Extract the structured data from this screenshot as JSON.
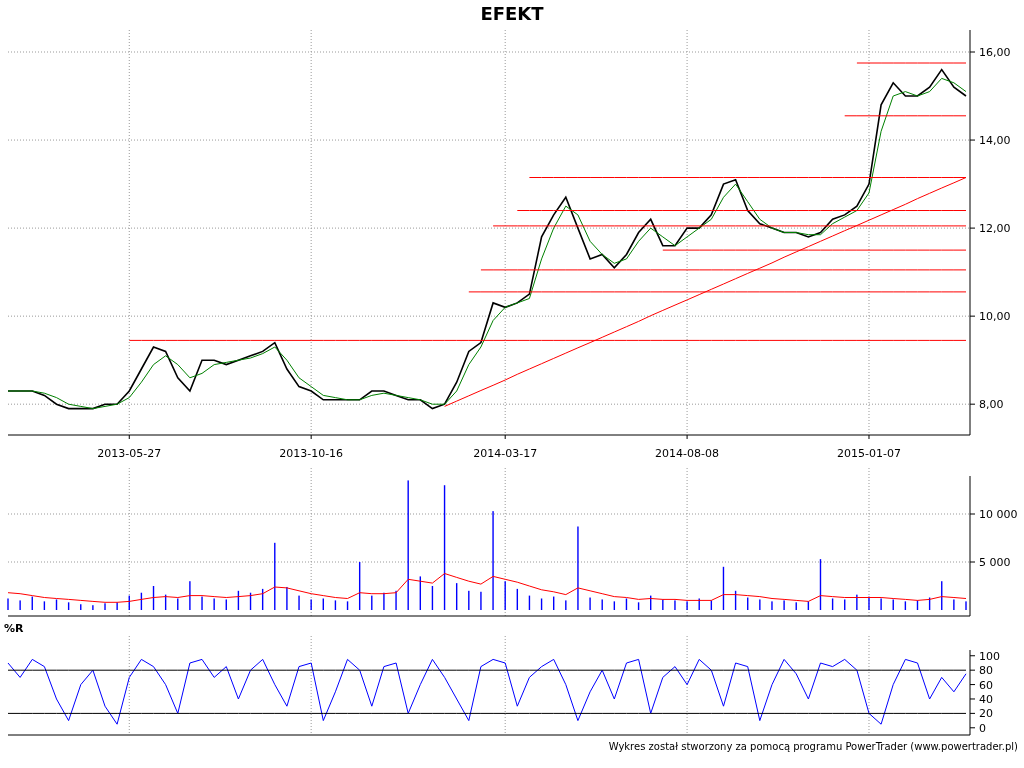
{
  "title": "EFEKT",
  "price_panel": {
    "chart_data": {
      "type": "line",
      "grid": true,
      "ylim": [
        7.3,
        16.5
      ],
      "categories": [
        null,
        null,
        null,
        null,
        null,
        null,
        null,
        null,
        null,
        null,
        "2013-05-27",
        null,
        null,
        null,
        null,
        null,
        null,
        null,
        null,
        null,
        null,
        null,
        null,
        null,
        null,
        "2013-10-16",
        null,
        null,
        null,
        null,
        null,
        null,
        null,
        null,
        null,
        null,
        null,
        null,
        null,
        null,
        null,
        "2014-03-17",
        null,
        null,
        null,
        null,
        null,
        null,
        null,
        null,
        null,
        null,
        null,
        null,
        null,
        null,
        "2014-08-08",
        null,
        null,
        null,
        null,
        null,
        null,
        null,
        null,
        null,
        null,
        null,
        null,
        null,
        null,
        "2015-01-07",
        null,
        null,
        null,
        null,
        null,
        null,
        null,
        null
      ],
      "yticks": [
        {
          "value": 8,
          "label": "8,00"
        },
        {
          "value": 10,
          "label": "10,00"
        },
        {
          "value": 12,
          "label": "12,00"
        },
        {
          "value": 14,
          "label": "14,00"
        },
        {
          "value": 16,
          "label": "16,00"
        }
      ],
      "series": [
        {
          "color": "#000000",
          "values": [
            8.3,
            8.3,
            8.3,
            8.2,
            8.0,
            7.9,
            7.9,
            7.9,
            8.0,
            8.0,
            8.3,
            8.8,
            9.3,
            9.2,
            8.6,
            8.3,
            9.0,
            9.0,
            8.9,
            9.0,
            9.1,
            9.2,
            9.4,
            8.8,
            8.4,
            8.3,
            8.1,
            8.1,
            8.1,
            8.1,
            8.3,
            8.3,
            8.2,
            8.1,
            8.1,
            7.9,
            8.0,
            8.5,
            9.2,
            9.4,
            10.3,
            10.2,
            10.3,
            10.5,
            11.8,
            12.3,
            12.7,
            12.0,
            11.3,
            11.4,
            11.1,
            11.4,
            11.9,
            12.2,
            11.6,
            11.6,
            12.0,
            12.0,
            12.3,
            13.0,
            13.1,
            12.4,
            12.1,
            12.0,
            11.9,
            11.9,
            11.8,
            11.9,
            12.2,
            12.3,
            12.5,
            13.0,
            14.8,
            15.3,
            15.0,
            15.0,
            15.2,
            15.6,
            15.2,
            15.0
          ]
        },
        {
          "color": "#008000",
          "values": [
            8.3,
            8.3,
            8.3,
            8.25,
            8.15,
            8.0,
            7.95,
            7.9,
            7.95,
            8.0,
            8.15,
            8.5,
            8.9,
            9.1,
            8.9,
            8.6,
            8.7,
            8.9,
            8.95,
            9.0,
            9.05,
            9.15,
            9.3,
            9.0,
            8.6,
            8.4,
            8.2,
            8.15,
            8.1,
            8.1,
            8.2,
            8.25,
            8.2,
            8.15,
            8.1,
            8.0,
            8.0,
            8.3,
            8.9,
            9.3,
            9.9,
            10.2,
            10.3,
            10.4,
            11.3,
            12.0,
            12.5,
            12.3,
            11.7,
            11.4,
            11.2,
            11.3,
            11.7,
            12.0,
            11.8,
            11.6,
            11.8,
            12.0,
            12.2,
            12.7,
            13.0,
            12.6,
            12.2,
            12.0,
            11.9,
            11.9,
            11.85,
            11.85,
            12.1,
            12.25,
            12.4,
            12.8,
            14.2,
            15.0,
            15.1,
            15.0,
            15.1,
            15.4,
            15.3,
            15.1
          ]
        },
        {
          "color": "#ff0000",
          "values": [
            null,
            null,
            null,
            null,
            null,
            null,
            null,
            null,
            null,
            null,
            9.45,
            9.45,
            9.45,
            9.45,
            9.45,
            9.45,
            9.45,
            9.45,
            9.45,
            9.45,
            9.45,
            9.45,
            9.45,
            9.45,
            9.45,
            9.45,
            9.45,
            9.45,
            9.45,
            9.45,
            9.45,
            9.45,
            9.45,
            9.45,
            9.45,
            9.45,
            9.45,
            9.45,
            9.45,
            9.45,
            9.45,
            9.45,
            9.45,
            9.45,
            9.45,
            9.45,
            9.45,
            9.45,
            9.45,
            9.45,
            9.45,
            9.45,
            9.45,
            9.45,
            9.45,
            9.45,
            9.45,
            9.45,
            9.45,
            9.45,
            9.45,
            9.45,
            9.45,
            9.45,
            9.45,
            9.45,
            9.45,
            9.45,
            9.45,
            9.45,
            9.45,
            9.45,
            9.45,
            9.45,
            9.45,
            9.45,
            9.45,
            9.45,
            9.45,
            9.45
          ]
        },
        {
          "color": "#ff0000",
          "values": [
            null,
            null,
            null,
            null,
            null,
            null,
            null,
            null,
            null,
            null,
            null,
            null,
            null,
            null,
            null,
            null,
            null,
            null,
            null,
            null,
            null,
            null,
            null,
            null,
            null,
            null,
            null,
            null,
            null,
            null,
            null,
            null,
            null,
            null,
            null,
            null,
            null,
            null,
            10.55,
            10.55,
            10.55,
            10.55,
            10.55,
            10.55,
            10.55,
            10.55,
            10.55,
            10.55,
            10.55,
            10.55,
            10.55,
            10.55,
            10.55,
            10.55,
            10.55,
            10.55,
            10.55,
            10.55,
            10.55,
            10.55,
            10.55,
            10.55,
            10.55,
            10.55,
            10.55,
            10.55,
            10.55,
            10.55,
            10.55,
            10.55,
            10.55,
            10.55,
            10.55,
            10.55,
            10.55,
            10.55,
            10.55,
            10.55,
            10.55,
            10.55
          ]
        },
        {
          "color": "#ff0000",
          "values": [
            null,
            null,
            null,
            null,
            null,
            null,
            null,
            null,
            null,
            null,
            null,
            null,
            null,
            null,
            null,
            null,
            null,
            null,
            null,
            null,
            null,
            null,
            null,
            null,
            null,
            null,
            null,
            null,
            null,
            null,
            null,
            null,
            null,
            null,
            null,
            null,
            null,
            null,
            null,
            11.05,
            11.05,
            11.05,
            11.05,
            11.05,
            11.05,
            11.05,
            11.05,
            11.05,
            11.05,
            11.05,
            11.05,
            11.05,
            11.05,
            11.05,
            11.05,
            11.05,
            11.05,
            11.05,
            11.05,
            11.05,
            11.05,
            11.05,
            11.05,
            11.05,
            11.05,
            11.05,
            11.05,
            11.05,
            11.05,
            11.05,
            11.05,
            11.05,
            11.05,
            11.05,
            11.05,
            11.05,
            11.05,
            11.05,
            11.05,
            11.05
          ]
        },
        {
          "color": "#ff0000",
          "values": [
            null,
            null,
            null,
            null,
            null,
            null,
            null,
            null,
            null,
            null,
            null,
            null,
            null,
            null,
            null,
            null,
            null,
            null,
            null,
            null,
            null,
            null,
            null,
            null,
            null,
            null,
            null,
            null,
            null,
            null,
            null,
            null,
            null,
            null,
            null,
            null,
            null,
            null,
            null,
            null,
            null,
            null,
            null,
            null,
            null,
            null,
            null,
            null,
            null,
            null,
            null,
            null,
            null,
            null,
            11.5,
            11.5,
            11.5,
            11.5,
            11.5,
            11.5,
            11.5,
            11.5,
            11.5,
            11.5,
            11.5,
            11.5,
            11.5,
            11.5,
            11.5,
            11.5,
            11.5,
            11.5,
            11.5,
            11.5,
            11.5,
            11.5,
            11.5,
            11.5,
            11.5,
            11.5
          ]
        },
        {
          "color": "#ff0000",
          "values": [
            null,
            null,
            null,
            null,
            null,
            null,
            null,
            null,
            null,
            null,
            null,
            null,
            null,
            null,
            null,
            null,
            null,
            null,
            null,
            null,
            null,
            null,
            null,
            null,
            null,
            null,
            null,
            null,
            null,
            null,
            null,
            null,
            null,
            null,
            null,
            null,
            null,
            null,
            null,
            null,
            12.05,
            12.05,
            12.05,
            12.05,
            12.05,
            12.05,
            12.05,
            12.05,
            12.05,
            12.05,
            12.05,
            12.05,
            12.05,
            12.05,
            12.05,
            12.05,
            12.05,
            12.05,
            12.05,
            12.05,
            12.05,
            12.05,
            12.05,
            12.05,
            12.05,
            12.05,
            12.05,
            12.05,
            12.05,
            12.05,
            12.05,
            12.05,
            12.05,
            12.05,
            12.05,
            12.05,
            12.05,
            12.05,
            12.05,
            12.05
          ]
        },
        {
          "color": "#ff0000",
          "values": [
            null,
            null,
            null,
            null,
            null,
            null,
            null,
            null,
            null,
            null,
            null,
            null,
            null,
            null,
            null,
            null,
            null,
            null,
            null,
            null,
            null,
            null,
            null,
            null,
            null,
            null,
            null,
            null,
            null,
            null,
            null,
            null,
            null,
            null,
            null,
            null,
            null,
            null,
            null,
            null,
            null,
            null,
            12.4,
            12.4,
            12.4,
            12.4,
            12.4,
            12.4,
            12.4,
            12.4,
            12.4,
            12.4,
            12.4,
            12.4,
            12.4,
            12.4,
            12.4,
            12.4,
            12.4,
            12.4,
            12.4,
            12.4,
            12.4,
            12.4,
            12.4,
            12.4,
            12.4,
            12.4,
            12.4,
            12.4,
            12.4,
            12.4,
            12.4,
            12.4,
            12.4,
            12.4,
            12.4,
            12.4,
            12.4,
            12.4
          ]
        },
        {
          "color": "#ff0000",
          "values": [
            null,
            null,
            null,
            null,
            null,
            null,
            null,
            null,
            null,
            null,
            null,
            null,
            null,
            null,
            null,
            null,
            null,
            null,
            null,
            null,
            null,
            null,
            null,
            null,
            null,
            null,
            null,
            null,
            null,
            null,
            null,
            null,
            null,
            null,
            null,
            null,
            null,
            null,
            null,
            null,
            null,
            null,
            null,
            13.15,
            13.15,
            13.15,
            13.15,
            13.15,
            13.15,
            13.15,
            13.15,
            13.15,
            13.15,
            13.15,
            13.15,
            13.15,
            13.15,
            13.15,
            13.15,
            13.15,
            13.15,
            13.15,
            13.15,
            13.15,
            13.15,
            13.15,
            13.15,
            13.15,
            13.15,
            13.15,
            13.15,
            13.15,
            13.15,
            13.15,
            13.15,
            13.15,
            13.15,
            13.15,
            13.15,
            13.15
          ]
        },
        {
          "color": "#ff0000",
          "values": [
            null,
            null,
            null,
            null,
            null,
            null,
            null,
            null,
            null,
            null,
            null,
            null,
            null,
            null,
            null,
            null,
            null,
            null,
            null,
            null,
            null,
            null,
            null,
            null,
            null,
            null,
            null,
            null,
            null,
            null,
            null,
            null,
            null,
            null,
            null,
            null,
            null,
            null,
            null,
            null,
            null,
            null,
            null,
            null,
            null,
            null,
            null,
            null,
            null,
            null,
            null,
            null,
            null,
            null,
            null,
            null,
            null,
            null,
            null,
            null,
            null,
            null,
            null,
            null,
            null,
            null,
            null,
            null,
            null,
            14.55,
            14.55,
            14.55,
            14.55,
            14.55,
            14.55,
            14.55,
            14.55,
            14.55,
            14.55,
            14.55
          ]
        },
        {
          "color": "#ff0000",
          "values": [
            null,
            null,
            null,
            null,
            null,
            null,
            null,
            null,
            null,
            null,
            null,
            null,
            null,
            null,
            null,
            null,
            null,
            null,
            null,
            null,
            null,
            null,
            null,
            null,
            null,
            null,
            null,
            null,
            null,
            null,
            null,
            null,
            null,
            null,
            null,
            null,
            null,
            null,
            null,
            null,
            null,
            null,
            null,
            null,
            null,
            null,
            null,
            null,
            null,
            null,
            null,
            null,
            null,
            null,
            null,
            null,
            null,
            null,
            null,
            null,
            null,
            null,
            null,
            null,
            null,
            null,
            null,
            null,
            null,
            null,
            15.75,
            15.75,
            15.75,
            15.75,
            15.75,
            15.75,
            15.75,
            15.75,
            15.75,
            15.75
          ]
        },
        {
          "color": "#ff0000",
          "values": [
            null,
            null,
            null,
            null,
            null,
            null,
            null,
            null,
            null,
            null,
            null,
            null,
            null,
            null,
            null,
            null,
            null,
            null,
            null,
            null,
            null,
            null,
            null,
            null,
            null,
            null,
            null,
            null,
            null,
            null,
            null,
            null,
            null,
            null,
            null,
            null,
            7.95,
            8.07,
            8.19,
            8.31,
            8.43,
            8.55,
            8.68,
            8.8,
            8.92,
            9.04,
            9.16,
            9.28,
            9.4,
            9.52,
            9.64,
            9.76,
            9.88,
            10.01,
            10.13,
            10.25,
            10.37,
            10.49,
            10.61,
            10.73,
            10.85,
            10.97,
            11.09,
            11.21,
            11.34,
            11.46,
            11.58,
            11.7,
            11.82,
            11.94,
            12.06,
            12.18,
            12.3,
            12.42,
            12.54,
            12.67,
            12.79,
            12.91,
            13.03,
            13.15
          ]
        }
      ]
    }
  },
  "volume_panel": {
    "chart_data": {
      "type": "bar",
      "grid": true,
      "ylim": [
        -625,
        13960
      ],
      "yticks": [
        {
          "value": 5000,
          "label": "5 000"
        },
        {
          "value": 10000,
          "label": "10 000"
        }
      ],
      "series": [
        {
          "color": "#0000ff",
          "values": [
            1200,
            1000,
            1400,
            900,
            1100,
            800,
            600,
            500,
            700,
            800,
            1500,
            1800,
            2500,
            1600,
            1200,
            3000,
            1400,
            1200,
            1100,
            2000,
            1800,
            2200,
            7000,
            2400,
            1500,
            1100,
            1200,
            1000,
            900,
            5000,
            1500,
            1800,
            2000,
            13500,
            3500,
            2500,
            13000,
            2800,
            2000,
            1900,
            10300,
            3000,
            2200,
            1500,
            1200,
            1400,
            1000,
            8700,
            1300,
            1100,
            900,
            1200,
            800,
            1500,
            1100,
            1000,
            900,
            1200,
            1000,
            4500,
            2000,
            1300,
            1100,
            900,
            1000,
            800,
            900,
            5300,
            1200,
            1100,
            1600,
            1400,
            1200,
            1100,
            900,
            1000,
            1300,
            3000,
            1100,
            900
          ]
        },
        {
          "type": "line",
          "color": "#ff0000",
          "values": [
            1800,
            1700,
            1500,
            1300,
            1200,
            1100,
            1000,
            900,
            800,
            800,
            900,
            1100,
            1300,
            1400,
            1300,
            1500,
            1500,
            1400,
            1300,
            1400,
            1500,
            1700,
            2400,
            2300,
            2000,
            1700,
            1500,
            1300,
            1200,
            1800,
            1700,
            1700,
            1800,
            3200,
            3000,
            2800,
            3800,
            3400,
            3000,
            2700,
            3500,
            3200,
            2900,
            2500,
            2100,
            1900,
            1600,
            2300,
            2000,
            1700,
            1400,
            1300,
            1100,
            1200,
            1100,
            1100,
            1000,
            1000,
            1000,
            1600,
            1600,
            1500,
            1400,
            1200,
            1100,
            1000,
            900,
            1500,
            1400,
            1300,
            1300,
            1300,
            1300,
            1200,
            1100,
            1000,
            1100,
            1400,
            1300,
            1200
          ]
        }
      ]
    }
  },
  "williams_panel": {
    "label": "%R",
    "chart_data": {
      "type": "line",
      "grid": true,
      "ylim": [
        -10,
        108
      ],
      "yticks": [
        0,
        20,
        40,
        60,
        80,
        100
      ],
      "series": [
        {
          "color": "#0000ff",
          "values": [
            90,
            70,
            95,
            85,
            40,
            10,
            60,
            80,
            30,
            5,
            70,
            95,
            85,
            60,
            20,
            90,
            95,
            70,
            85,
            40,
            80,
            95,
            60,
            30,
            85,
            90,
            10,
            50,
            95,
            80,
            30,
            85,
            90,
            20,
            60,
            95,
            70,
            40,
            10,
            85,
            95,
            90,
            30,
            70,
            85,
            95,
            60,
            10,
            50,
            80,
            40,
            90,
            95,
            20,
            70,
            85,
            60,
            95,
            80,
            30,
            90,
            85,
            10,
            60,
            95,
            75,
            40,
            90,
            85,
            95,
            80,
            20,
            5,
            60,
            95,
            90,
            40,
            70,
            50,
            75
          ]
        },
        {
          "color": "#000000",
          "values": [
            80,
            80,
            80,
            80,
            80,
            80,
            80,
            80,
            80,
            80,
            80,
            80,
            80,
            80,
            80,
            80,
            80,
            80,
            80,
            80,
            80,
            80,
            80,
            80,
            80,
            80,
            80,
            80,
            80,
            80,
            80,
            80,
            80,
            80,
            80,
            80,
            80,
            80,
            80,
            80,
            80,
            80,
            80,
            80,
            80,
            80,
            80,
            80,
            80,
            80,
            80,
            80,
            80,
            80,
            80,
            80,
            80,
            80,
            80,
            80,
            80,
            80,
            80,
            80,
            80,
            80,
            80,
            80,
            80,
            80,
            80,
            80,
            80,
            80,
            80,
            80,
            80,
            80,
            80,
            80
          ]
        },
        {
          "color": "#000000",
          "values": [
            20,
            20,
            20,
            20,
            20,
            20,
            20,
            20,
            20,
            20,
            20,
            20,
            20,
            20,
            20,
            20,
            20,
            20,
            20,
            20,
            20,
            20,
            20,
            20,
            20,
            20,
            20,
            20,
            20,
            20,
            20,
            20,
            20,
            20,
            20,
            20,
            20,
            20,
            20,
            20,
            20,
            20,
            20,
            20,
            20,
            20,
            20,
            20,
            20,
            20,
            20,
            20,
            20,
            20,
            20,
            20,
            20,
            20,
            20,
            20,
            20,
            20,
            20,
            20,
            20,
            20,
            20,
            20,
            20,
            20,
            20,
            20,
            20,
            20,
            20,
            20,
            20,
            20,
            20,
            20
          ]
        }
      ]
    }
  },
  "footer": "Wykres został stworzony za pomocą programu PowerTrader (www.powertrader.pl)"
}
